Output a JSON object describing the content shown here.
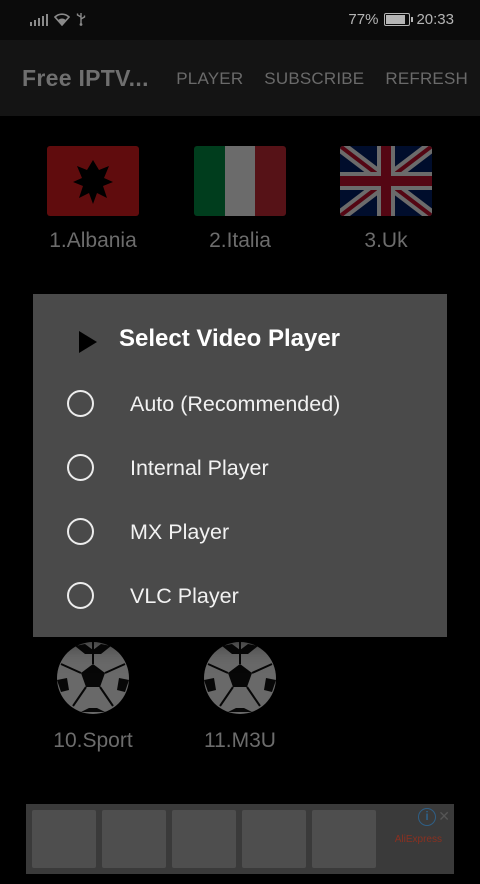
{
  "status_bar": {
    "battery_percent": "77%",
    "battery_level": 0.77,
    "time": "20:33",
    "icons": [
      "signal-icon",
      "wifi-icon",
      "usb-icon",
      "battery-charging-icon"
    ]
  },
  "app_bar": {
    "title": "Free IPTV...",
    "menu": [
      "PLAYER",
      "SUBSCRIBE",
      "REFRESH"
    ]
  },
  "channels": [
    {
      "label": "1.Albania",
      "icon": "albania-flag-icon"
    },
    {
      "label": "2.Italia",
      "icon": "italy-flag-icon"
    },
    {
      "label": "3.Uk",
      "icon": "uk-flag-icon"
    },
    {
      "label": "10.Sport",
      "icon": "soccer-ball-icon"
    },
    {
      "label": "11.M3U",
      "icon": "soccer-ball-icon"
    }
  ],
  "dialog": {
    "title": "Select Video Player",
    "title_icon": "play-icon",
    "options": [
      {
        "label": "Auto (Recommended)",
        "selected": false
      },
      {
        "label": "Internal Player",
        "selected": false
      },
      {
        "label": "MX Player",
        "selected": false
      },
      {
        "label": "VLC Player",
        "selected": false
      }
    ]
  },
  "ad": {
    "brand": "AliExpress",
    "icons": [
      "ad-info-icon",
      "ad-close-icon"
    ]
  },
  "colors": {
    "dialog_bg": "#4a4a4a",
    "appbar_bg": "#141414",
    "dim_text": "#6c6c6c"
  }
}
